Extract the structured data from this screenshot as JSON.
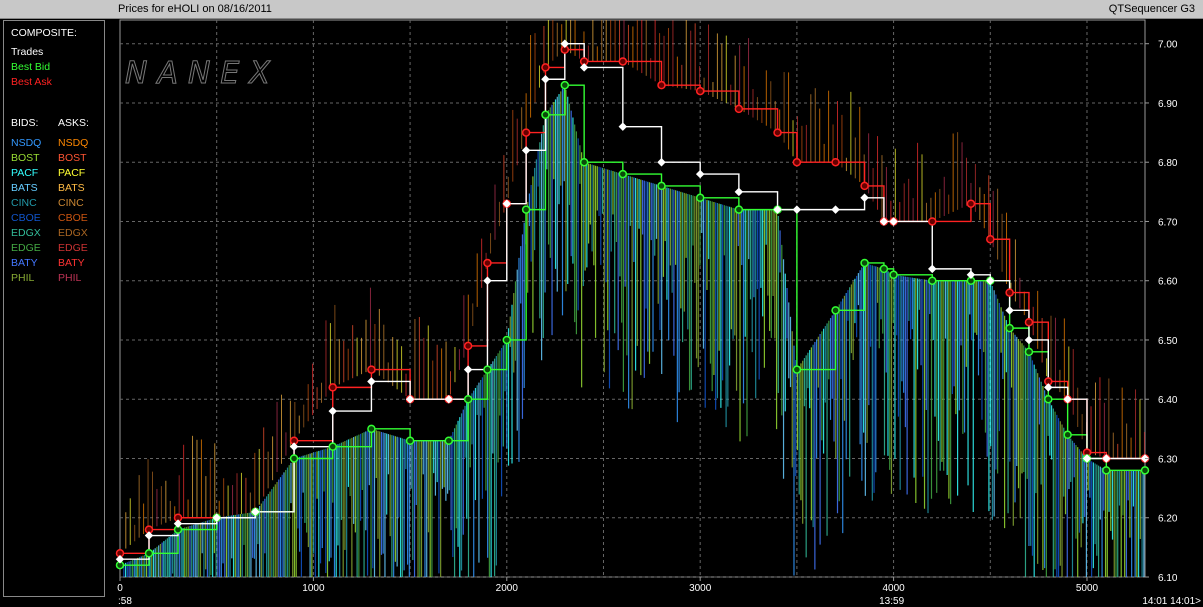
{
  "window": {
    "title_left": "Prices for  eHOLI  on  08/16/2011",
    "title_right": "QTSequencer G3"
  },
  "legend": {
    "composite_header": "COMPOSITE:",
    "composite_items": [
      {
        "label": "Trades",
        "color": "#ffffff"
      },
      {
        "label": "Best Bid",
        "color": "#33ff33"
      },
      {
        "label": "Best Ask",
        "color": "#ff2222"
      }
    ],
    "bids_header": "BIDS:",
    "asks_header": "ASKS:",
    "bids": [
      {
        "label": "NSDQ",
        "color": "#3399ff"
      },
      {
        "label": "BOST",
        "color": "#99dd33"
      },
      {
        "label": "PACF",
        "color": "#33ffff"
      },
      {
        "label": "BATS",
        "color": "#66ccff"
      },
      {
        "label": "CINC",
        "color": "#2299aa"
      },
      {
        "label": "CBOE",
        "color": "#1155cc"
      },
      {
        "label": "EDGX",
        "color": "#33bb99"
      },
      {
        "label": "EDGE",
        "color": "#44aa44"
      },
      {
        "label": "BATY",
        "color": "#4477ff"
      },
      {
        "label": "PHIL",
        "color": "#88aa33"
      }
    ],
    "asks": [
      {
        "label": "NSDQ",
        "color": "#ff8800"
      },
      {
        "label": "BOST",
        "color": "#ff5533"
      },
      {
        "label": "PACF",
        "color": "#ffff33"
      },
      {
        "label": "BATS",
        "color": "#ffbb44"
      },
      {
        "label": "CINC",
        "color": "#cc8833"
      },
      {
        "label": "CBOE",
        "color": "#cc5511"
      },
      {
        "label": "EDGX",
        "color": "#aa6622"
      },
      {
        "label": "EDGE",
        "color": "#cc3333"
      },
      {
        "label": "BATY",
        "color": "#ff3333"
      },
      {
        "label": "PHIL",
        "color": "#bb3355"
      }
    ]
  },
  "chart_data": {
    "type": "line",
    "watermark": "NANEX",
    "xlim": [
      0,
      5300
    ],
    "ylim": [
      6.1,
      7.04
    ],
    "x_ticks": [
      0,
      1000,
      2000,
      3000,
      4000,
      5000
    ],
    "y_ticks": [
      "7.00",
      "6.90",
      "6.80",
      "6.70",
      "6.60",
      "6.50",
      "6.40",
      "6.30",
      "6.20",
      "6.10"
    ],
    "time_labels": [
      {
        "x": 0,
        "text": ":58"
      },
      {
        "x": 3990,
        "text": "13:59"
      },
      {
        "x": 5250,
        "text": "14:01 14:01>"
      }
    ],
    "grid": true,
    "series": [
      {
        "name": "Best Ask",
        "color": "#ff2222",
        "x": [
          0,
          150,
          300,
          500,
          700,
          900,
          1100,
          1300,
          1500,
          1700,
          1800,
          1900,
          2000,
          2100,
          2200,
          2300,
          2400,
          2600,
          2800,
          3000,
          3200,
          3400,
          3500,
          3700,
          3850,
          3950,
          4000,
          4200,
          4400,
          4500,
          4600,
          4700,
          4800,
          4900,
          5000,
          5100,
          5300
        ],
        "y": [
          6.14,
          6.18,
          6.2,
          6.2,
          6.21,
          6.33,
          6.42,
          6.45,
          6.4,
          6.4,
          6.49,
          6.63,
          6.73,
          6.85,
          6.96,
          6.99,
          6.97,
          6.97,
          6.93,
          6.92,
          6.89,
          6.85,
          6.8,
          6.8,
          6.76,
          6.7,
          6.7,
          6.7,
          6.73,
          6.67,
          6.58,
          6.53,
          6.43,
          6.4,
          6.31,
          6.3,
          6.3
        ]
      },
      {
        "name": "Best Bid",
        "color": "#33ff33",
        "x": [
          0,
          150,
          300,
          500,
          700,
          900,
          1100,
          1300,
          1500,
          1700,
          1800,
          1900,
          2000,
          2100,
          2200,
          2300,
          2400,
          2600,
          2800,
          3000,
          3200,
          3400,
          3500,
          3700,
          3850,
          3950,
          4000,
          4200,
          4400,
          4500,
          4600,
          4700,
          4800,
          4900,
          5000,
          5100,
          5300
        ],
        "y": [
          6.12,
          6.14,
          6.18,
          6.2,
          6.21,
          6.3,
          6.32,
          6.35,
          6.33,
          6.33,
          6.4,
          6.45,
          6.5,
          6.72,
          6.88,
          6.93,
          6.8,
          6.78,
          6.76,
          6.74,
          6.72,
          6.72,
          6.45,
          6.55,
          6.63,
          6.62,
          6.61,
          6.6,
          6.6,
          6.6,
          6.52,
          6.48,
          6.4,
          6.34,
          6.3,
          6.28,
          6.28
        ]
      },
      {
        "name": "Trades",
        "color": "#ffffff",
        "x": [
          0,
          150,
          300,
          500,
          700,
          900,
          1100,
          1300,
          1500,
          1700,
          1800,
          1900,
          2000,
          2100,
          2200,
          2300,
          2400,
          2600,
          2800,
          3000,
          3200,
          3400,
          3500,
          3700,
          3850,
          3950,
          4000,
          4200,
          4400,
          4500,
          4600,
          4700,
          4800,
          4900,
          5000,
          5100,
          5300
        ],
        "y": [
          6.13,
          6.17,
          6.19,
          6.2,
          6.21,
          6.32,
          6.38,
          6.43,
          6.4,
          6.4,
          6.45,
          6.6,
          6.73,
          6.82,
          6.94,
          7.0,
          6.96,
          6.86,
          6.8,
          6.78,
          6.75,
          6.72,
          6.72,
          6.72,
          6.74,
          6.7,
          6.7,
          6.62,
          6.61,
          6.6,
          6.55,
          6.5,
          6.42,
          6.4,
          6.3,
          6.3,
          6.3
        ]
      }
    ]
  }
}
